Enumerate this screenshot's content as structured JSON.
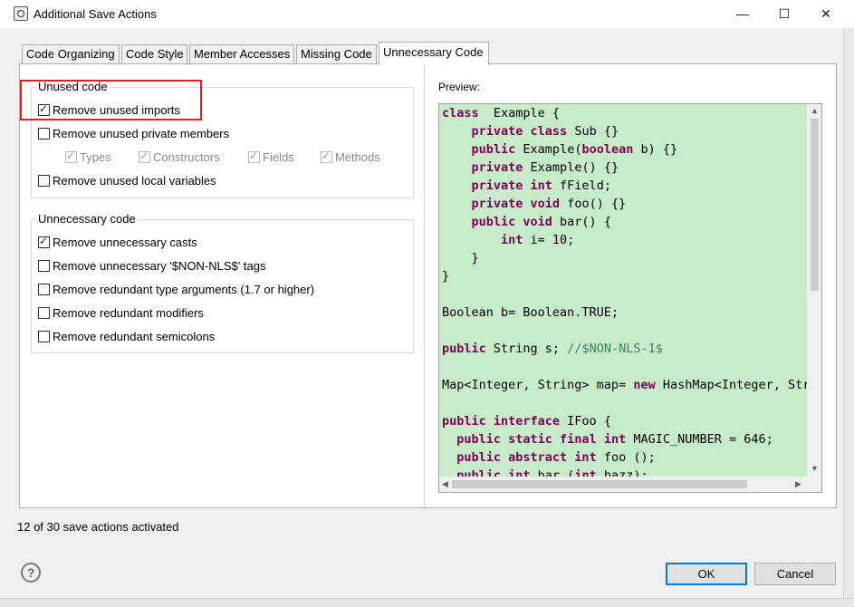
{
  "window": {
    "title": "Additional Save Actions",
    "minimize": "—",
    "maximize": "☐",
    "close": "✕"
  },
  "tabs": [
    {
      "label": "Code Organizing"
    },
    {
      "label": "Code Style"
    },
    {
      "label": "Member Accesses"
    },
    {
      "label": "Missing Code"
    },
    {
      "label": "Unnecessary Code",
      "active": true
    }
  ],
  "unused_code": {
    "title": "Unused code",
    "remove_unused_imports": {
      "label": "Remove unused imports",
      "checked": true
    },
    "remove_unused_private_members": {
      "label": "Remove unused private members",
      "checked": false
    },
    "types": {
      "label": "Types",
      "checked": true,
      "enabled": false
    },
    "constructors": {
      "label": "Constructors",
      "checked": true,
      "enabled": false
    },
    "fields": {
      "label": "Fields",
      "checked": true,
      "enabled": false
    },
    "methods": {
      "label": "Methods",
      "checked": true,
      "enabled": false
    },
    "remove_unused_local_variables": {
      "label": "Remove unused local variables",
      "checked": false
    }
  },
  "unnecessary_code": {
    "title": "Unnecessary code",
    "remove_unnecessary_casts": {
      "label": "Remove unnecessary casts",
      "checked": true
    },
    "remove_unnecessary_nls_tags": {
      "label": "Remove unnecessary '$NON-NLS$' tags",
      "checked": false
    },
    "remove_redundant_type_arguments": {
      "label": "Remove redundant type arguments (1.7 or higher)",
      "checked": false
    },
    "remove_redundant_modifiers": {
      "label": "Remove redundant modifiers",
      "checked": false
    },
    "remove_redundant_semicolons": {
      "label": "Remove redundant semicolons",
      "checked": false
    }
  },
  "preview": {
    "label": "Preview:",
    "code_lines": [
      [
        [
          "kw",
          "class"
        ],
        [
          "",
          "  Example {"
        ]
      ],
      [
        [
          "",
          "    "
        ],
        [
          "kw",
          "private class"
        ],
        [
          "",
          " Sub {}"
        ]
      ],
      [
        [
          "",
          "    "
        ],
        [
          "kw",
          "public"
        ],
        [
          "",
          " Example("
        ],
        [
          "kw",
          "boolean"
        ],
        [
          "",
          " b) {}"
        ]
      ],
      [
        [
          "",
          "    "
        ],
        [
          "kw",
          "private"
        ],
        [
          "",
          " Example() {}"
        ]
      ],
      [
        [
          "",
          "    "
        ],
        [
          "kw",
          "private int"
        ],
        [
          "",
          " fField;"
        ]
      ],
      [
        [
          "",
          "    "
        ],
        [
          "kw",
          "private void"
        ],
        [
          "",
          " foo() {}"
        ]
      ],
      [
        [
          "",
          "    "
        ],
        [
          "kw",
          "public void"
        ],
        [
          "",
          " bar() {"
        ]
      ],
      [
        [
          "",
          "        "
        ],
        [
          "kw",
          "int"
        ],
        [
          "",
          " i= 10;"
        ]
      ],
      [
        [
          "",
          "    }"
        ]
      ],
      [
        [
          "",
          "}"
        ]
      ],
      [
        [
          "",
          ""
        ]
      ],
      [
        [
          "",
          "Boolean b= Boolean.TRUE;"
        ]
      ],
      [
        [
          "",
          ""
        ]
      ],
      [
        [
          "kw",
          "public"
        ],
        [
          "",
          " String s; "
        ],
        [
          "cm",
          "//$NON-NLS-1$"
        ]
      ],
      [
        [
          "",
          ""
        ]
      ],
      [
        [
          "",
          "Map<Integer, String> map= "
        ],
        [
          "kw",
          "new"
        ],
        [
          "",
          " HashMap<Integer, String>();"
        ]
      ],
      [
        [
          "",
          ""
        ]
      ],
      [
        [
          "kw",
          "public interface"
        ],
        [
          "",
          " IFoo {"
        ]
      ],
      [
        [
          "",
          "  "
        ],
        [
          "kw",
          "public static final int"
        ],
        [
          "",
          " MAGIC_NUMBER = 646;"
        ]
      ],
      [
        [
          "",
          "  "
        ],
        [
          "kw",
          "public abstract int"
        ],
        [
          "",
          " foo ();"
        ]
      ],
      [
        [
          "",
          "  "
        ],
        [
          "kw",
          "public int"
        ],
        [
          "",
          " bar ("
        ],
        [
          "kw",
          "int"
        ],
        [
          "",
          " bazz);"
        ]
      ]
    ]
  },
  "status": "12 of 30 save actions activated",
  "buttons": {
    "help": "?",
    "ok": "OK",
    "cancel": "Cancel"
  },
  "colors": {
    "preview_background": "#c7ecc9",
    "keyword": "#7f0055",
    "comment": "#3f7f5f",
    "highlight_box": "#e02020",
    "default_button_border": "#0078d7"
  }
}
